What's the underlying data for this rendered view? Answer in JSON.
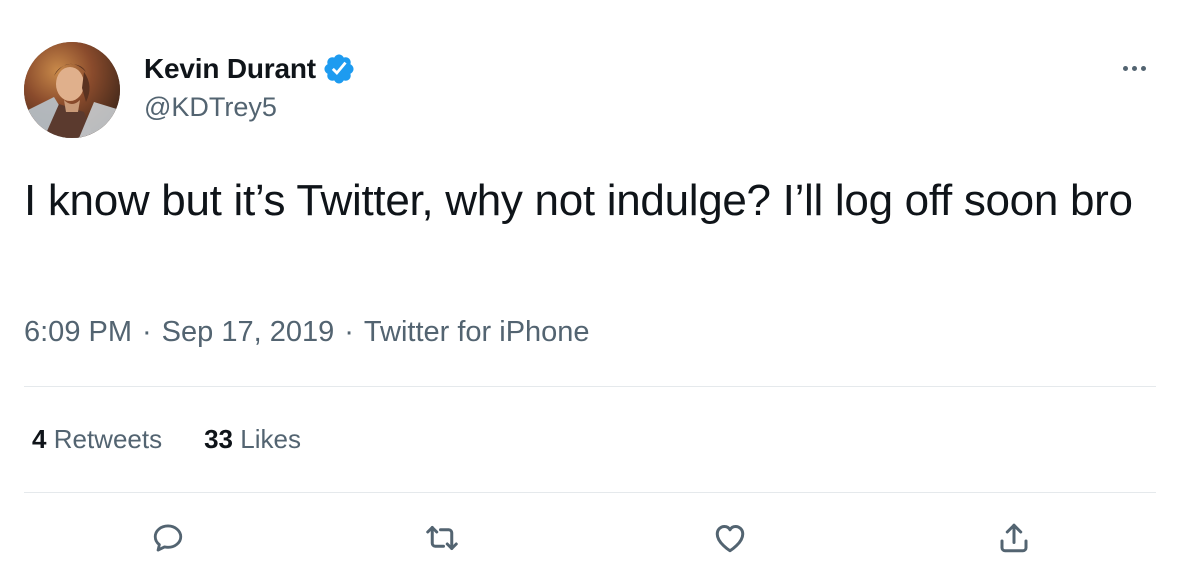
{
  "user": {
    "display_name": "Kevin Durant",
    "handle": "@KDTrey5",
    "verified": true,
    "avatar_icon": "avatar-portrait"
  },
  "tweet": {
    "text": "I know but it’s Twitter, why not indulge? I’ll log off soon bro",
    "time": "6:09 PM",
    "separator": "·",
    "date": "Sep 17, 2019",
    "source": "Twitter for iPhone"
  },
  "stats": {
    "retweets_count": "4",
    "retweets_label": "Retweets",
    "likes_count": "33",
    "likes_label": "Likes"
  },
  "actions": {
    "reply_icon": "reply-icon",
    "retweet_icon": "retweet-icon",
    "like_icon": "heart-icon",
    "share_icon": "share-icon"
  },
  "colors": {
    "text_primary": "#0f1419",
    "text_secondary": "#536471",
    "verified_blue": "#1d9bf0",
    "divider": "#e5e9ec"
  }
}
